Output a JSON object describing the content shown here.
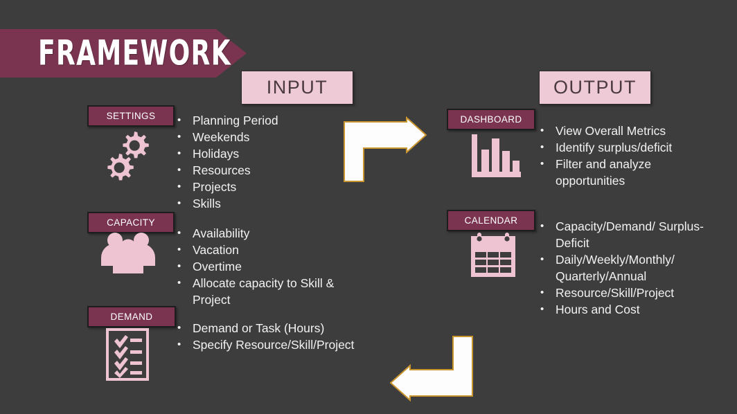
{
  "slide": {
    "title": "FRAMEWORK",
    "background_color": "#3d3d3d",
    "accent_color": "#7b3450",
    "chip_color": "#eec9d6",
    "icon_color": "#eec3d2",
    "text_color": "#f2f2f2"
  },
  "headers": {
    "input": "INPUT",
    "output": "OUTPUT"
  },
  "sections": {
    "settings": {
      "label": "SETTINGS",
      "icon": "gears-icon",
      "items": [
        "Planning Period",
        "Weekends",
        "Holidays",
        "Resources",
        "Projects",
        "Skills"
      ]
    },
    "capacity": {
      "label": "CAPACITY",
      "icon": "people-group-icon",
      "items": [
        "Availability",
        "Vacation",
        "Overtime",
        "Allocate capacity to Skill & Project"
      ]
    },
    "demand": {
      "label": "DEMAND",
      "icon": "checklist-clipboard-icon",
      "items": [
        "Demand or Task (Hours)",
        "Specify Resource/Skill/Project"
      ]
    },
    "dashboard": {
      "label": "DASHBOARD",
      "icon": "bar-chart-icon",
      "items": [
        "View Overall Metrics",
        "Identify surplus/deficit",
        "Filter and analyze opportunities"
      ]
    },
    "calendar": {
      "label": "CALENDAR",
      "icon": "calendar-icon",
      "items": [
        "Capacity/Demand/ Surplus-Deficit",
        "Daily/Weekly/Monthly/ Quarterly/Annual",
        "Resource/Skill/Project",
        "Hours and Cost"
      ]
    }
  },
  "arrows": {
    "top": "bent-arrow-right-icon",
    "bottom": "bent-arrow-left-icon",
    "fill": "#ffffff",
    "stroke": "#c9952f"
  },
  "bullet_glyph": "•"
}
